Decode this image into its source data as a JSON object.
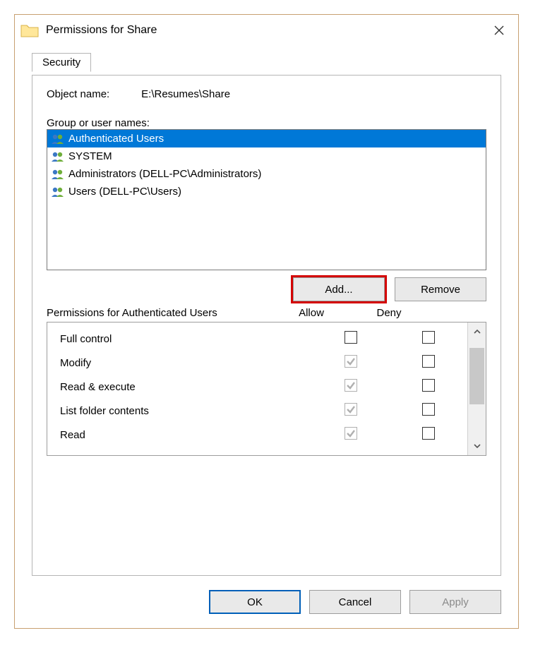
{
  "window": {
    "title": "Permissions for Share"
  },
  "tabs": {
    "security": "Security"
  },
  "object": {
    "label": "Object name:",
    "value": "E:\\Resumes\\Share"
  },
  "group": {
    "label": "Group or user names:",
    "items": [
      {
        "name": "Authenticated Users",
        "selected": true
      },
      {
        "name": "SYSTEM",
        "selected": false
      },
      {
        "name": "Administrators (DELL-PC\\Administrators)",
        "selected": false
      },
      {
        "name": "Users (DELL-PC\\Users)",
        "selected": false
      }
    ]
  },
  "buttons": {
    "add": "Add...",
    "remove": "Remove",
    "ok": "OK",
    "cancel": "Cancel",
    "apply": "Apply"
  },
  "permissions": {
    "title": "Permissions for Authenticated Users",
    "col_allow": "Allow",
    "col_deny": "Deny",
    "items": [
      {
        "name": "Full control",
        "allow": "unchecked",
        "deny": "unchecked"
      },
      {
        "name": "Modify",
        "allow": "checked-disabled",
        "deny": "unchecked"
      },
      {
        "name": "Read & execute",
        "allow": "checked-disabled",
        "deny": "unchecked"
      },
      {
        "name": "List folder contents",
        "allow": "checked-disabled",
        "deny": "unchecked"
      },
      {
        "name": "Read",
        "allow": "checked-disabled",
        "deny": "unchecked"
      }
    ]
  },
  "icons": {
    "folder": "folder-icon",
    "close": "close-icon",
    "users": "users-group-icon",
    "chevron_up": "chevron-up-icon",
    "chevron_down": "chevron-down-icon"
  }
}
